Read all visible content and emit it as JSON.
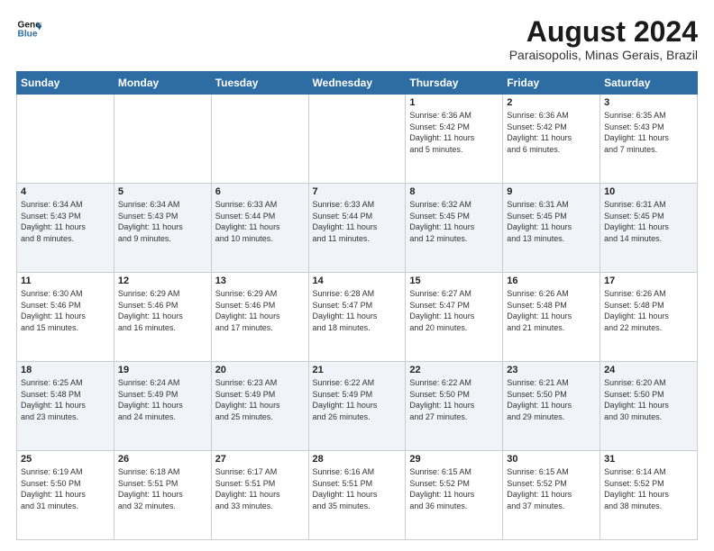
{
  "header": {
    "logo_line1": "General",
    "logo_line2": "Blue",
    "main_title": "August 2024",
    "subtitle": "Paraisopolis, Minas Gerais, Brazil"
  },
  "weekdays": [
    "Sunday",
    "Monday",
    "Tuesday",
    "Wednesday",
    "Thursday",
    "Friday",
    "Saturday"
  ],
  "weeks": [
    [
      {
        "day": "",
        "info": ""
      },
      {
        "day": "",
        "info": ""
      },
      {
        "day": "",
        "info": ""
      },
      {
        "day": "",
        "info": ""
      },
      {
        "day": "1",
        "info": "Sunrise: 6:36 AM\nSunset: 5:42 PM\nDaylight: 11 hours\nand 5 minutes."
      },
      {
        "day": "2",
        "info": "Sunrise: 6:36 AM\nSunset: 5:42 PM\nDaylight: 11 hours\nand 6 minutes."
      },
      {
        "day": "3",
        "info": "Sunrise: 6:35 AM\nSunset: 5:43 PM\nDaylight: 11 hours\nand 7 minutes."
      }
    ],
    [
      {
        "day": "4",
        "info": "Sunrise: 6:34 AM\nSunset: 5:43 PM\nDaylight: 11 hours\nand 8 minutes."
      },
      {
        "day": "5",
        "info": "Sunrise: 6:34 AM\nSunset: 5:43 PM\nDaylight: 11 hours\nand 9 minutes."
      },
      {
        "day": "6",
        "info": "Sunrise: 6:33 AM\nSunset: 5:44 PM\nDaylight: 11 hours\nand 10 minutes."
      },
      {
        "day": "7",
        "info": "Sunrise: 6:33 AM\nSunset: 5:44 PM\nDaylight: 11 hours\nand 11 minutes."
      },
      {
        "day": "8",
        "info": "Sunrise: 6:32 AM\nSunset: 5:45 PM\nDaylight: 11 hours\nand 12 minutes."
      },
      {
        "day": "9",
        "info": "Sunrise: 6:31 AM\nSunset: 5:45 PM\nDaylight: 11 hours\nand 13 minutes."
      },
      {
        "day": "10",
        "info": "Sunrise: 6:31 AM\nSunset: 5:45 PM\nDaylight: 11 hours\nand 14 minutes."
      }
    ],
    [
      {
        "day": "11",
        "info": "Sunrise: 6:30 AM\nSunset: 5:46 PM\nDaylight: 11 hours\nand 15 minutes."
      },
      {
        "day": "12",
        "info": "Sunrise: 6:29 AM\nSunset: 5:46 PM\nDaylight: 11 hours\nand 16 minutes."
      },
      {
        "day": "13",
        "info": "Sunrise: 6:29 AM\nSunset: 5:46 PM\nDaylight: 11 hours\nand 17 minutes."
      },
      {
        "day": "14",
        "info": "Sunrise: 6:28 AM\nSunset: 5:47 PM\nDaylight: 11 hours\nand 18 minutes."
      },
      {
        "day": "15",
        "info": "Sunrise: 6:27 AM\nSunset: 5:47 PM\nDaylight: 11 hours\nand 20 minutes."
      },
      {
        "day": "16",
        "info": "Sunrise: 6:26 AM\nSunset: 5:48 PM\nDaylight: 11 hours\nand 21 minutes."
      },
      {
        "day": "17",
        "info": "Sunrise: 6:26 AM\nSunset: 5:48 PM\nDaylight: 11 hours\nand 22 minutes."
      }
    ],
    [
      {
        "day": "18",
        "info": "Sunrise: 6:25 AM\nSunset: 5:48 PM\nDaylight: 11 hours\nand 23 minutes."
      },
      {
        "day": "19",
        "info": "Sunrise: 6:24 AM\nSunset: 5:49 PM\nDaylight: 11 hours\nand 24 minutes."
      },
      {
        "day": "20",
        "info": "Sunrise: 6:23 AM\nSunset: 5:49 PM\nDaylight: 11 hours\nand 25 minutes."
      },
      {
        "day": "21",
        "info": "Sunrise: 6:22 AM\nSunset: 5:49 PM\nDaylight: 11 hours\nand 26 minutes."
      },
      {
        "day": "22",
        "info": "Sunrise: 6:22 AM\nSunset: 5:50 PM\nDaylight: 11 hours\nand 27 minutes."
      },
      {
        "day": "23",
        "info": "Sunrise: 6:21 AM\nSunset: 5:50 PM\nDaylight: 11 hours\nand 29 minutes."
      },
      {
        "day": "24",
        "info": "Sunrise: 6:20 AM\nSunset: 5:50 PM\nDaylight: 11 hours\nand 30 minutes."
      }
    ],
    [
      {
        "day": "25",
        "info": "Sunrise: 6:19 AM\nSunset: 5:50 PM\nDaylight: 11 hours\nand 31 minutes."
      },
      {
        "day": "26",
        "info": "Sunrise: 6:18 AM\nSunset: 5:51 PM\nDaylight: 11 hours\nand 32 minutes."
      },
      {
        "day": "27",
        "info": "Sunrise: 6:17 AM\nSunset: 5:51 PM\nDaylight: 11 hours\nand 33 minutes."
      },
      {
        "day": "28",
        "info": "Sunrise: 6:16 AM\nSunset: 5:51 PM\nDaylight: 11 hours\nand 35 minutes."
      },
      {
        "day": "29",
        "info": "Sunrise: 6:15 AM\nSunset: 5:52 PM\nDaylight: 11 hours\nand 36 minutes."
      },
      {
        "day": "30",
        "info": "Sunrise: 6:15 AM\nSunset: 5:52 PM\nDaylight: 11 hours\nand 37 minutes."
      },
      {
        "day": "31",
        "info": "Sunrise: 6:14 AM\nSunset: 5:52 PM\nDaylight: 11 hours\nand 38 minutes."
      }
    ]
  ]
}
